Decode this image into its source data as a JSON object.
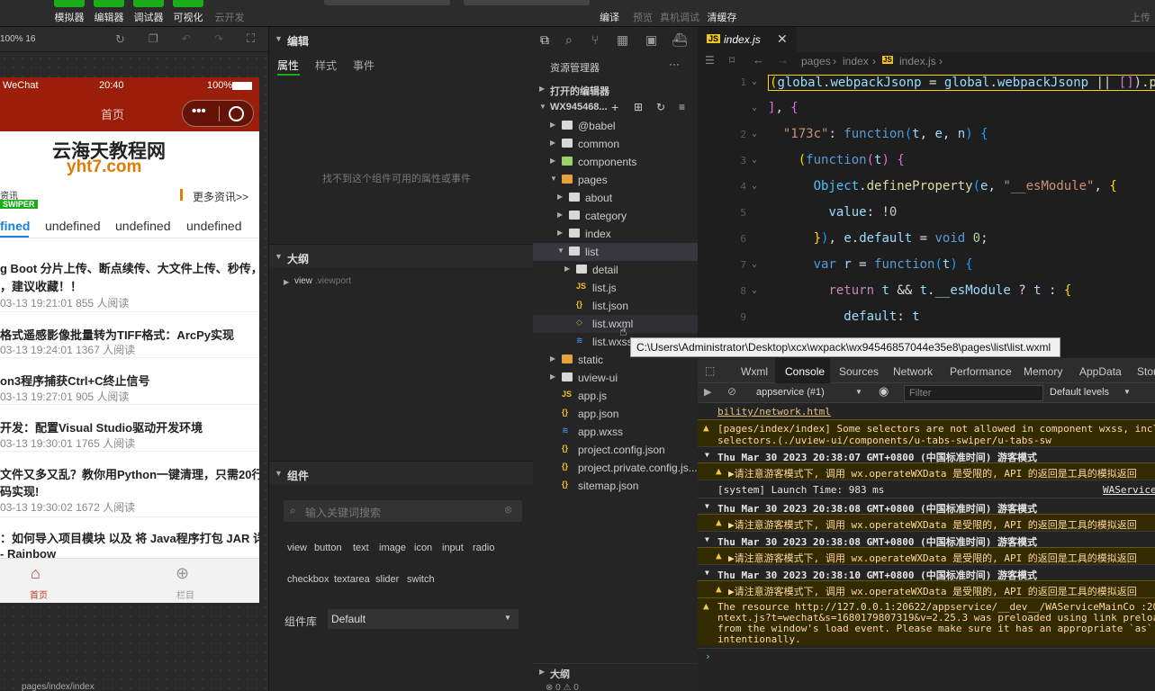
{
  "toolbar": {
    "simulator": "模拟器",
    "editor": "编辑器",
    "debugger": "调试器",
    "visual": "可视化",
    "cloud": "云开发",
    "compile": "编译",
    "preview": "预览",
    "real_debug": "真机调试",
    "clear_cache": "清缓存",
    "upload": "上传"
  },
  "sim": {
    "zoom": "100% 16",
    "status_carrier": "WeChat",
    "status_time": "20:40",
    "status_battery": "100%",
    "nav_title": "首页",
    "logo_main": "云海天教程网",
    "logo_sub": "yht7.com",
    "section_left": "资讯",
    "swiper_badge": "SWIPER",
    "more_link": "更多资讯>>",
    "tabs": [
      "fined",
      "undefined",
      "undefined",
      "undefined"
    ],
    "articles": [
      {
        "title": "g Boot 分片上传、断点续传、大文件上传、秒传，应",
        "title2": "，建议收藏！！",
        "meta": "03-13 19:21:01 855 人阅读"
      },
      {
        "title": "格式遥感影像批量转为TIFF格式：ArcPy实现",
        "title2": "",
        "meta": "03-13 19:24:01 1367 人阅读"
      },
      {
        "title": "on3程序捕获Ctrl+C终止信号",
        "title2": "",
        "meta": "03-13 19:27:01 905 人阅读"
      },
      {
        "title": "开发：配置Visual Studio驱动开发环境",
        "title2": "",
        "meta": "03-13 19:30:01 1765 人阅读"
      },
      {
        "title": "文件又多又乱？教你用Python一键清理，只需20行代",
        "title2": "码实现!",
        "meta": "03-13 19:30:02 1672 人阅读"
      },
      {
        "title": "：如何导入项目模块 以及 将 Java程序打包 JAR 详",
        "title2": "- Rainbow",
        "meta": ""
      }
    ],
    "tabbar_home": "首页",
    "tabbar_column": "栏目",
    "footer_path": "pages/index/index"
  },
  "inspector": {
    "edit_title": "编辑",
    "tabs": [
      "属性",
      "样式",
      "事件"
    ],
    "empty_msg": "找不到这个组件可用的属性或事件",
    "outline_title": "大纲",
    "outline_node": "view",
    "outline_node_class": ".viewport",
    "component_title": "组件",
    "search_placeholder": "输入关键词搜索",
    "components": [
      "view",
      "button",
      "text",
      "image",
      "icon",
      "input",
      "radio",
      "checkbox",
      "textarea",
      "slider",
      "switch"
    ],
    "lib_label": "组件库",
    "lib_value": "Default"
  },
  "explorer": {
    "title": "资源管理器",
    "open_editors": "打开的编辑器",
    "project": "WX945468...",
    "items": [
      {
        "name": "@babel",
        "type": "folder",
        "depth": 1
      },
      {
        "name": "common",
        "type": "folder",
        "depth": 1
      },
      {
        "name": "components",
        "type": "folder-green",
        "depth": 1
      },
      {
        "name": "pages",
        "type": "folder-orange",
        "depth": 1,
        "open": true
      },
      {
        "name": "about",
        "type": "folder",
        "depth": 2
      },
      {
        "name": "category",
        "type": "folder",
        "depth": 2
      },
      {
        "name": "index",
        "type": "folder",
        "depth": 2
      },
      {
        "name": "list",
        "type": "folder",
        "depth": 2,
        "open": true
      },
      {
        "name": "detail",
        "type": "folder",
        "depth": 3
      },
      {
        "name": "list.js",
        "type": "js",
        "depth": 3
      },
      {
        "name": "list.json",
        "type": "json",
        "depth": 3
      },
      {
        "name": "list.wxml",
        "type": "wxml",
        "depth": 3
      },
      {
        "name": "list.wxss",
        "type": "wxss",
        "depth": 3
      },
      {
        "name": "static",
        "type": "folder-orange",
        "depth": 1
      },
      {
        "name": "uview-ui",
        "type": "folder",
        "depth": 1
      },
      {
        "name": "app.js",
        "type": "js",
        "depth": 1
      },
      {
        "name": "app.json",
        "type": "json",
        "depth": 1
      },
      {
        "name": "app.wxss",
        "type": "wxss",
        "depth": 1
      },
      {
        "name": "project.config.json",
        "type": "json",
        "depth": 1
      },
      {
        "name": "project.private.config.js...",
        "type": "json",
        "depth": 1
      },
      {
        "name": "sitemap.json",
        "type": "json",
        "depth": 1
      }
    ],
    "outline": "大纲",
    "status": "⊗ 0 ⚠ 0"
  },
  "tooltip": "C:\\Users\\Administrator\\Desktop\\xcx\\wxpack\\wx94546857044e35e8\\pages\\list\\list.wxml",
  "editor": {
    "tab_name": "index.js",
    "breadcrumb": [
      "pages",
      "index",
      "index.js"
    ],
    "lines": [
      "1",
      "",
      "2",
      "3",
      "4",
      "5",
      "6",
      "7",
      "8",
      "9"
    ]
  },
  "devtools": {
    "tabs": [
      "Wxml",
      "Console",
      "Sources",
      "Network",
      "Performance",
      "Memory",
      "AppData",
      "Stor"
    ],
    "context": "appservice (#1)",
    "filter_placeholder": "Filter",
    "levels": "Default levels",
    "console": [
      {
        "kind": "link",
        "text": "bility/network.html"
      },
      {
        "kind": "warn",
        "text": "[pages/index/index] Some selectors are not allowed in component wxss, including t",
        "text2": "selectors.(./uview-ui/components/u-tabs-swiper/u-tabs-sw"
      },
      {
        "kind": "grp",
        "text": "Thu Mar 30 2023 20:38:07 GMT+0800 (中国标准时间) 游客模式"
      },
      {
        "kind": "warn",
        "text": "▶请注意游客模式下, 调用 wx.operateWXData 是受限的, API 的返回是工具的模拟返回"
      },
      {
        "kind": "info",
        "text": "[system] Launch Time: 983 ms",
        "src": "WAService"
      },
      {
        "kind": "grp",
        "text": "Thu Mar 30 2023 20:38:08 GMT+0800 (中国标准时间) 游客模式"
      },
      {
        "kind": "warn",
        "text": "▶请注意游客模式下, 调用 wx.operateWXData 是受限的, API 的返回是工具的模拟返回"
      },
      {
        "kind": "grp",
        "text": "Thu Mar 30 2023 20:38:08 GMT+0800 (中国标准时间) 游客模式"
      },
      {
        "kind": "warn",
        "text": "▶请注意游客模式下, 调用 wx.operateWXData 是受限的, API 的返回是工具的模拟返回"
      },
      {
        "kind": "grp",
        "text": "Thu Mar 30 2023 20:38:10 GMT+0800 (中国标准时间) 游客模式"
      },
      {
        "kind": "warn",
        "text": "▶请注意游客模式下, 调用 wx.operateWXData 是受限的, API 的返回是工具的模拟返回"
      },
      {
        "kind": "warn3",
        "text": "The resource http://127.0.0.1:20622/appservice/__dev__/WAServiceMainCo :20622/app",
        "text2": "ntext.js?t=wechat&s=1680179807319&v=2.25.3 was preloaded using link preload but n",
        "text3": "from the window's load event. Please make sure it has an appropriate `as` value a",
        "text4": "intentionally."
      }
    ]
  },
  "colors": {
    "accent": "#1aad19",
    "phone_header": "#9a1e0a",
    "warn_bg": "#332b00"
  }
}
